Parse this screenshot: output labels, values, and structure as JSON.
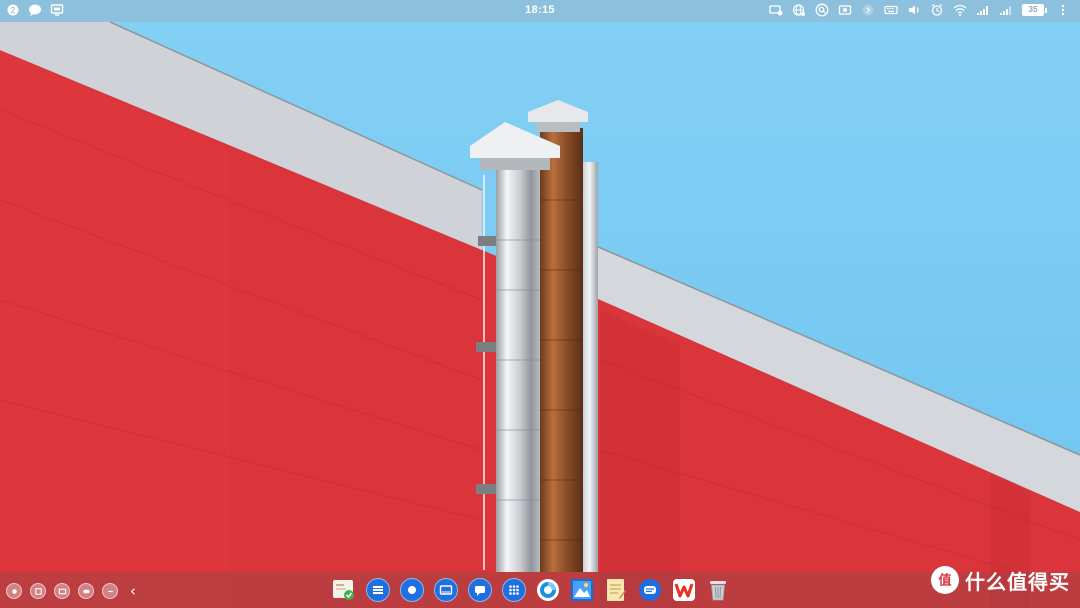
{
  "status_bar": {
    "time": "18:15",
    "battery_level": "35",
    "left_icons": [
      "badge-icon",
      "chat-icon",
      "screen-icon"
    ],
    "right_icons": [
      "cast-icon",
      "globe-icon",
      "search-circle-icon",
      "record-icon",
      "chevron-right-icon",
      "keyboard-icon",
      "volume-icon",
      "alarm-icon",
      "wifi-icon",
      "signal-icon",
      "signal-icon",
      "battery-icon",
      "more-icon"
    ]
  },
  "dock": {
    "left_controls": [
      "home-icon",
      "tasks-icon",
      "window-icon",
      "toggle-icon",
      "back-icon",
      "collapse-icon"
    ],
    "apps": [
      "file-manager-icon",
      "grid-app-icon",
      "dot-app-icon",
      "screen-app-icon",
      "chat-app-icon",
      "apps-grid-icon",
      "browser-icon",
      "photo-viewer-icon",
      "notepad-icon",
      "messages-icon",
      "wps-office-icon",
      "trash-icon"
    ]
  },
  "watermark": {
    "text": "什么值得买",
    "logo_glyph": "值"
  },
  "colors": {
    "sky": "#7ccbf2",
    "wall_red": "#d9333a",
    "roof_grey": "#d4d7db",
    "status_bar": "#9ab6c9",
    "dock_blue": "#1f6fde"
  }
}
